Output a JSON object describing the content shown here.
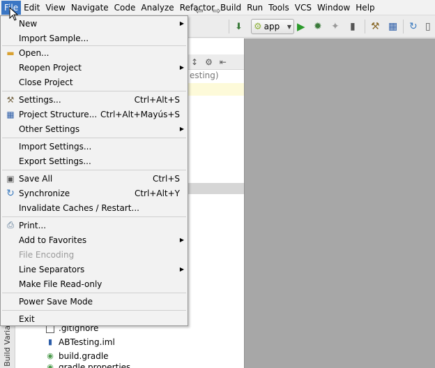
{
  "menubar": {
    "items": [
      "File",
      "Edit",
      "View",
      "Navigate",
      "Code",
      "Analyze",
      "Refactor",
      "Build",
      "Run",
      "Tools",
      "VCS",
      "Window",
      "Help"
    ],
    "active_index": 0
  },
  "toolbar": {
    "run_config": "app",
    "icons": [
      "back-icon",
      "forward-icon",
      "make-icon",
      "run-icon",
      "debug-icon",
      "attach-debugger-icon",
      "avd-manager-icon",
      "project-structure-icon",
      "sdk-manager-icon",
      "sync-icon",
      "device-icon"
    ]
  },
  "file_menu": {
    "new": "New",
    "import_sample": "Import Sample...",
    "open": "Open...",
    "reopen_project": "Reopen Project",
    "close_project": "Close Project",
    "settings": "Settings...",
    "settings_shortcut": "Ctrl+Alt+S",
    "project_structure": "Project Structure...",
    "project_structure_shortcut": "Ctrl+Alt+Mayús+S",
    "other_settings": "Other Settings",
    "import_settings": "Import Settings...",
    "export_settings": "Export Settings...",
    "save_all": "Save All",
    "save_all_shortcut": "Ctrl+S",
    "synchronize": "Synchronize",
    "synchronize_shortcut": "Ctrl+Alt+Y",
    "invalidate_caches": "Invalidate Caches / Restart...",
    "print": "Print...",
    "add_to_favorites": "Add to Favorites",
    "file_encoding": "File Encoding",
    "line_separators": "Line Separators",
    "make_read_only": "Make File Read-only",
    "power_save_mode": "Power Save Mode",
    "exit": "Exit"
  },
  "project_panel": {
    "partial_text": "esting)",
    "side_tab": "Build Variants",
    "files": [
      ".gitignore",
      "ABTesting.iml",
      "build.gradle",
      "gradle.properties"
    ]
  },
  "colors": {
    "menu_highlight": "#3a76c4",
    "editor_background": "#a7a7a7",
    "row_highlight": "#fdfad9"
  }
}
